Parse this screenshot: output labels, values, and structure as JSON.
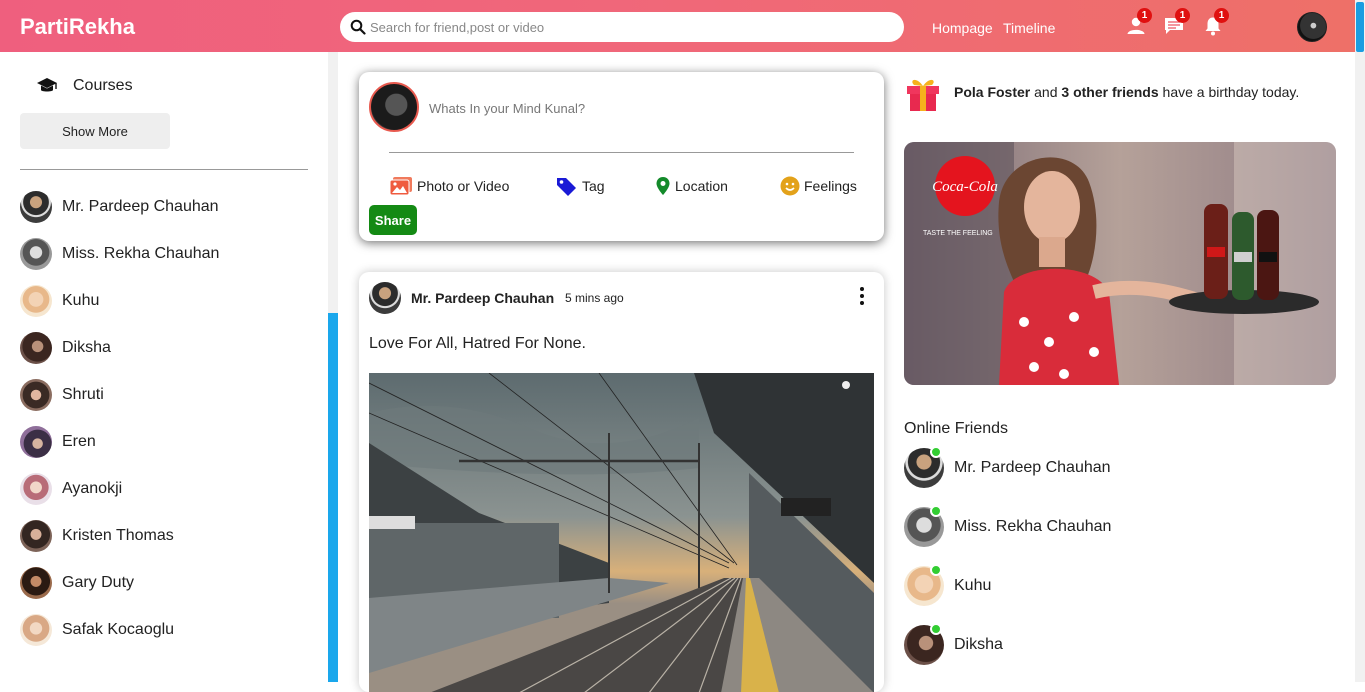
{
  "header": {
    "logo": "PartiRekha",
    "search_placeholder": "Search for friend,post or video",
    "links": [
      "Hompage",
      "Timeline"
    ],
    "badges": {
      "friend_requests": "1",
      "messages": "1",
      "notifications": "1"
    }
  },
  "sidebar": {
    "course_label": "Courses",
    "show_more_label": "Show More",
    "friends": [
      "Mr. Pardeep Chauhan",
      "Miss. Rekha Chauhan",
      "Kuhu",
      "Diksha",
      "Shruti",
      "Eren",
      "Ayanokji",
      "Kristen Thomas",
      "Gary Duty",
      "Safak Kocaoglu"
    ]
  },
  "composer": {
    "placeholder": "Whats In your Mind Kunal?",
    "options": [
      "Photo or Video",
      "Tag",
      "Location",
      "Feelings"
    ],
    "share_label": "Share"
  },
  "post": {
    "author": "Mr. Pardeep Chauhan",
    "time": "5 mins ago",
    "text": "Love For All, Hatred For None."
  },
  "rightbar": {
    "birthday": {
      "name": "Pola Foster",
      "middle": " and ",
      "others": "3 other friends",
      "suffix": " have a birthday today."
    },
    "ad": {
      "brand": "Coca-Cola",
      "tagline": "TASTE THE FEELING"
    },
    "online_title": "Online Friends",
    "online_friends": [
      "Mr. Pardeep Chauhan",
      "Miss. Rekha Chauhan",
      "Kuhu",
      "Diksha"
    ]
  },
  "colors": {
    "header_gradient_start": "#ef5f7e",
    "header_gradient_end": "#ee7068",
    "share_button": "#148a14",
    "online_dot": "#32cd32",
    "badge": "#e01010",
    "scroll_accent": "#1aa7ec"
  }
}
